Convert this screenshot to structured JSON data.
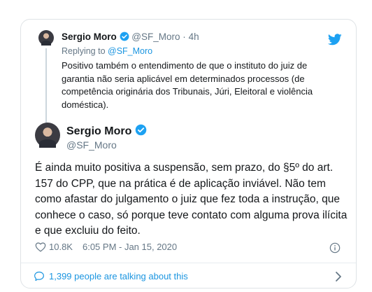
{
  "reply": {
    "name": "Sergio Moro",
    "handle": "@SF_Moro",
    "separator": "·",
    "time": "4h",
    "replying_prefix": "Replying to ",
    "replying_to": "@SF_Moro",
    "text": "Positivo também o entendimento de que o instituto do juiz de garantia não seria aplicável em determinados processos (de competência originária dos Tribunais, Júri, Eleitoral e violência doméstica)."
  },
  "tweet": {
    "name": "Sergio Moro",
    "handle": "@SF_Moro",
    "text": "É ainda muito positiva a suspensão, sem prazo, do §5º do art. 157 do CPP, que na prática é de aplicação inviável. Não tem como afastar do julgamento o juiz que fez toda a instrução, que conhece o caso, só porque teve contato com alguma prova ilícita e que excluiu do feito.",
    "likes": "10.8K",
    "timestamp": "6:05 PM - Jan 15, 2020"
  },
  "footer": {
    "talking": "1,399 people are talking about this"
  },
  "colors": {
    "twitter_blue": "#1da1f2",
    "link_blue": "#1b95e0",
    "muted_grey": "#657786",
    "border": "#dfe3e6"
  },
  "icons": [
    "twitter-bird-icon",
    "verified-badge-icon",
    "heart-icon",
    "info-icon",
    "comment-bubble-icon",
    "chevron-right-icon"
  ]
}
